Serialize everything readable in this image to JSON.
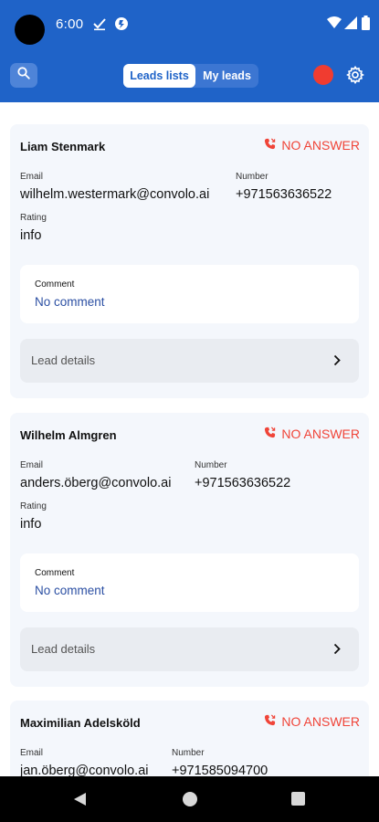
{
  "status_bar": {
    "time": "6:00",
    "icons": [
      "checkmark-download-icon",
      "app-notification-icon",
      "wifi-icon",
      "signal-icon",
      "battery-icon"
    ]
  },
  "app_bar": {
    "tabs": [
      {
        "label": "Leads lists",
        "active": true
      },
      {
        "label": "My leads",
        "active": false
      }
    ],
    "icons": [
      "search-icon",
      "record-indicator",
      "gear-icon"
    ],
    "colors": {
      "bar": "#1f63c8",
      "record": "#f03c30"
    }
  },
  "leads": [
    {
      "name": "Liam Stenmark",
      "status": "NO ANSWER",
      "email_label": "Email",
      "email": "wilhelm.westermark@convolo.ai",
      "number_label": "Number",
      "number": "+971563636522",
      "rating_label": "Rating",
      "rating": "info",
      "comment_label": "Comment",
      "comment": "No comment",
      "details_label": "Lead details"
    },
    {
      "name": "Wilhelm Almgren",
      "status": "NO ANSWER",
      "email_label": "Email",
      "email": "anders.öberg@convolo.ai",
      "number_label": "Number",
      "number": "+971563636522",
      "rating_label": "Rating",
      "rating": "info",
      "comment_label": "Comment",
      "comment": "No comment",
      "details_label": "Lead details"
    },
    {
      "name": "Maximilian Adelsköld",
      "status": "NO ANSWER",
      "email_label": "Email",
      "email": "jan.öberg@convolo.ai",
      "number_label": "Number",
      "number": "+971585094700"
    }
  ],
  "colors": {
    "status": "#f04438",
    "comment_text": "#2b4fa3"
  }
}
